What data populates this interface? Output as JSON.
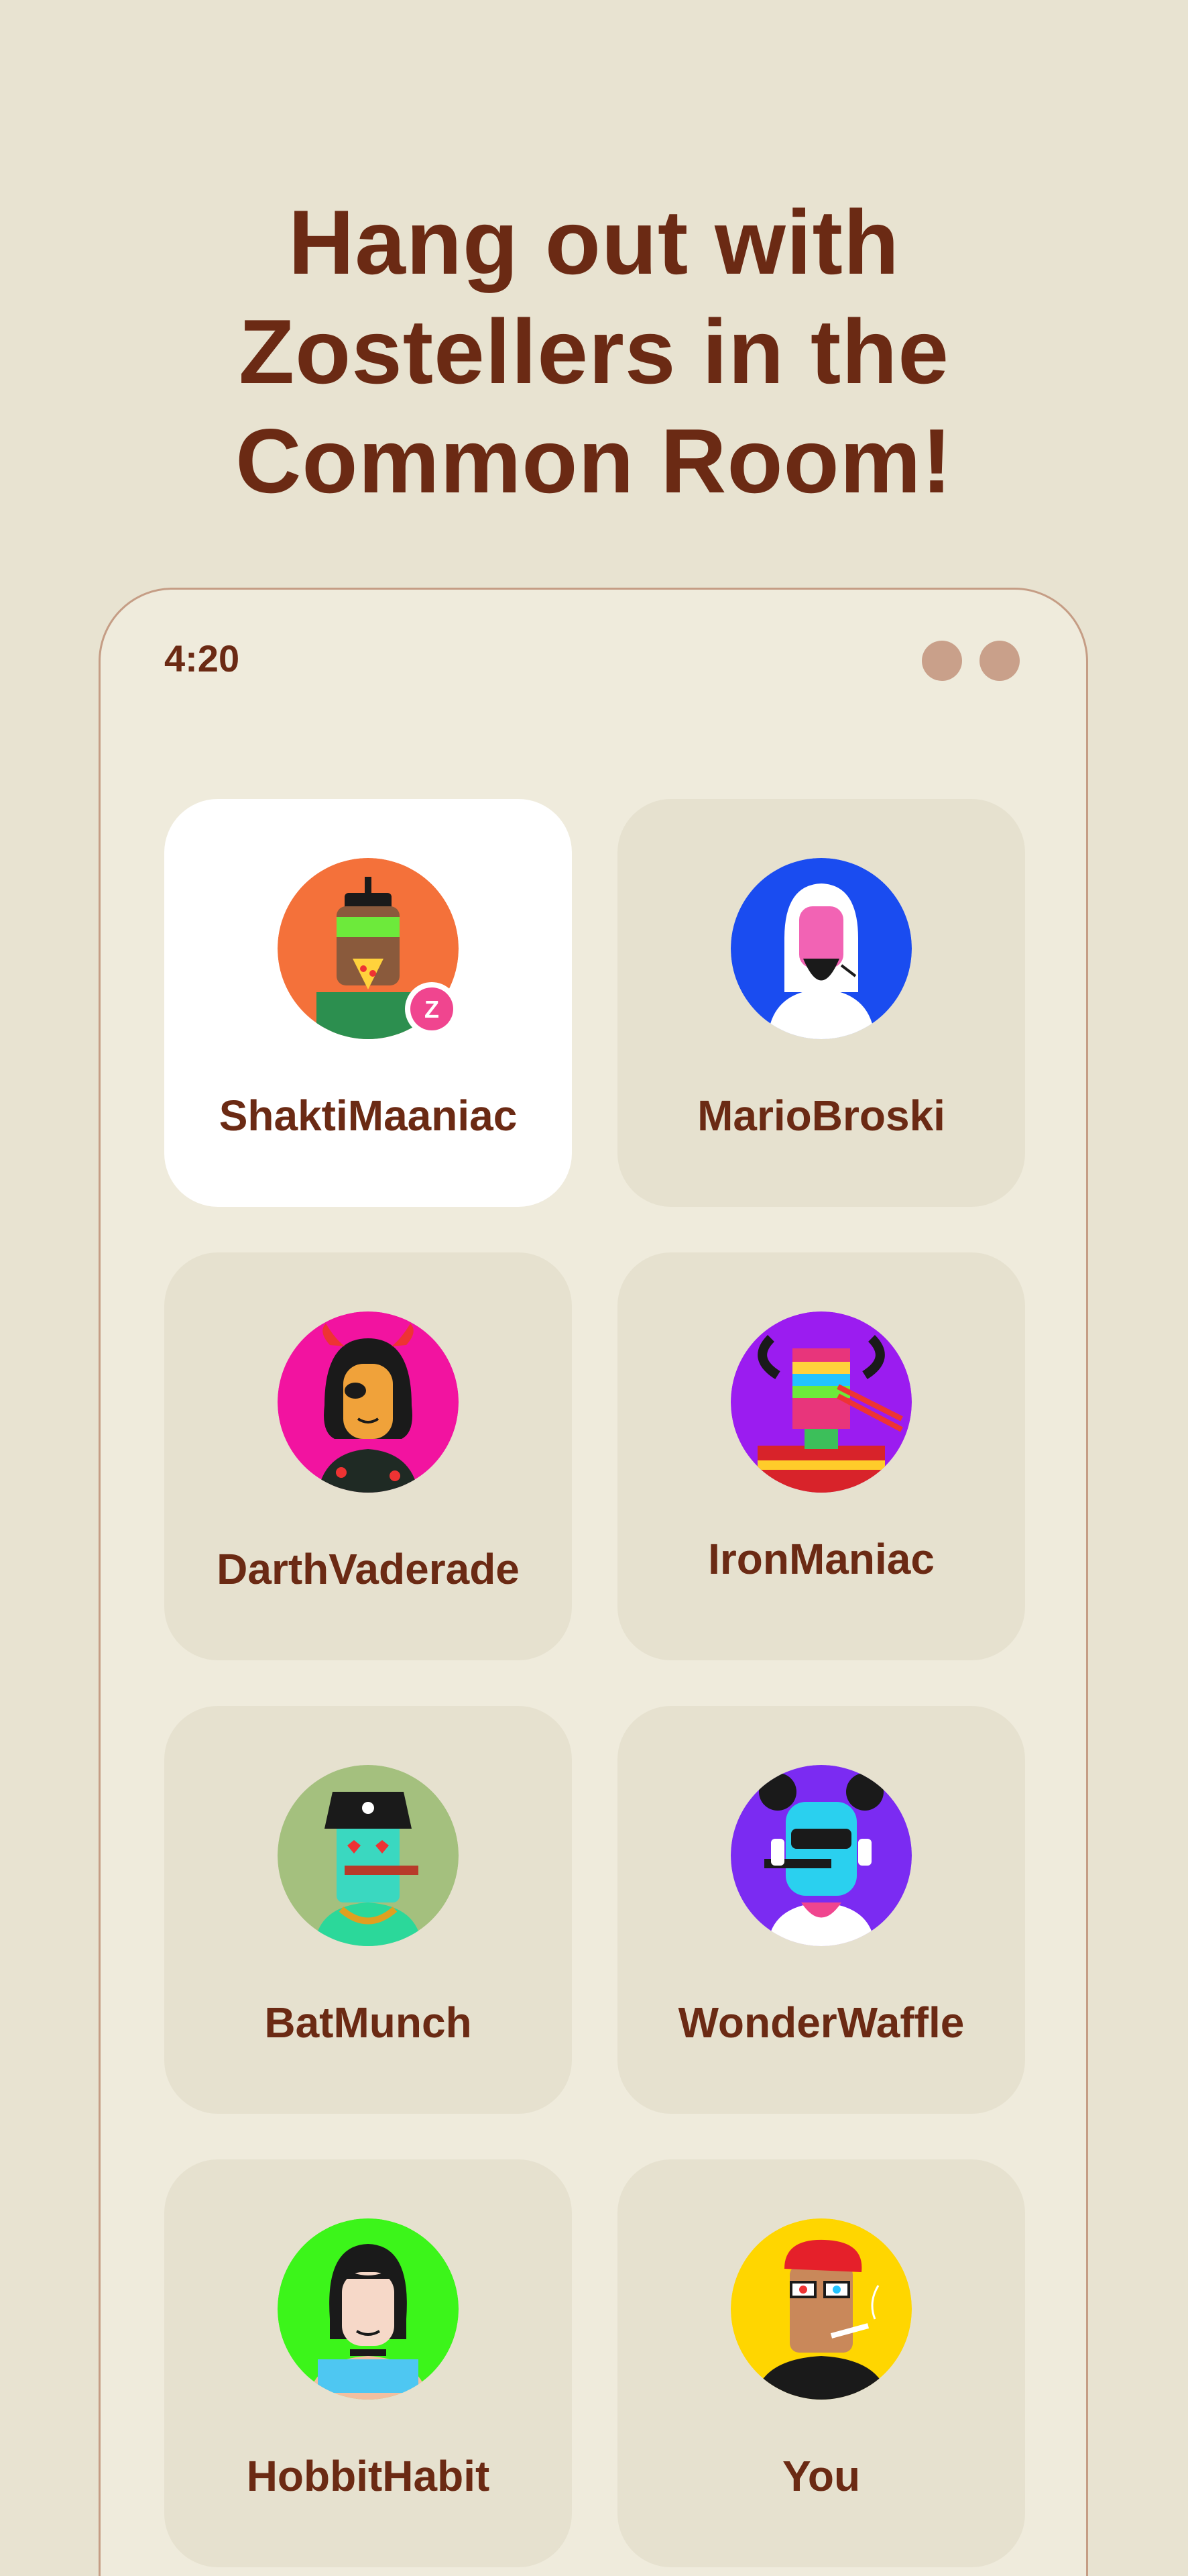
{
  "headline": {
    "line1": "Hang out with",
    "line2": "Zostellers in the",
    "line3": "Common Room!"
  },
  "status_bar": {
    "time": "4:20"
  },
  "badge_letter": "Z",
  "members": [
    {
      "name": "ShaktiMaaniac",
      "avatar_color": "#f4713a",
      "selected": true,
      "badge": true
    },
    {
      "name": "MarioBroski",
      "avatar_color": "#1a4cf0"
    },
    {
      "name": "DarthVaderade",
      "avatar_color": "#f213a0"
    },
    {
      "name": "IronManiac",
      "avatar_color": "#9b1cf0"
    },
    {
      "name": "BatMunch",
      "avatar_color": "#a4c07e"
    },
    {
      "name": "WonderWaffle",
      "avatar_color": "#7b2bf2"
    },
    {
      "name": "HobbitHabit",
      "avatar_color": "#3cf51a"
    },
    {
      "name": "You",
      "avatar_color": "#ffd600"
    }
  ],
  "colors": {
    "background": "#e8e3d1",
    "text_brown": "#6b2a14",
    "phone_border": "#c59d85",
    "card": "#e6e1cf",
    "card_selected": "#ffffff",
    "badge_pink": "#f0458f"
  }
}
